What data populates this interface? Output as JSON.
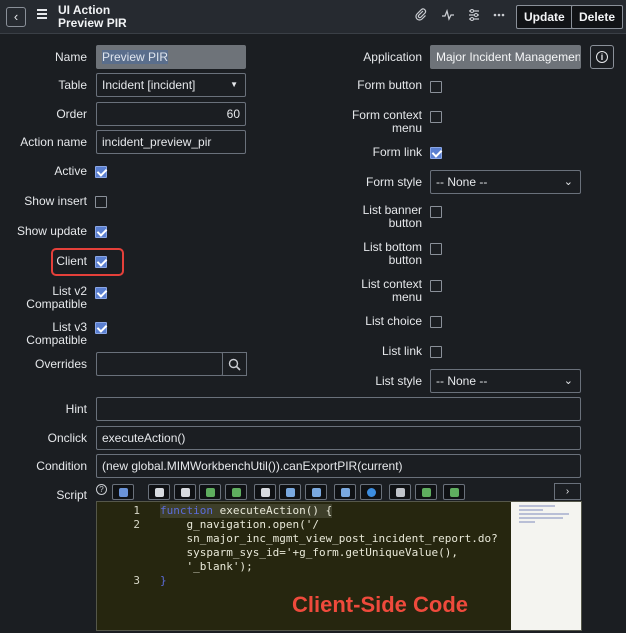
{
  "header": {
    "title": "UI Action",
    "subtitle": "Preview PIR",
    "update_label": "Update",
    "delete_label": "Delete"
  },
  "left_fields": {
    "name_label": "Name",
    "name_value": "Preview PIR",
    "table_label": "Table",
    "table_value": "Incident [incident]",
    "order_label": "Order",
    "order_value": "60",
    "action_name_label": "Action name",
    "action_name_value": "incident_preview_pir",
    "active_label": "Active",
    "show_insert_label": "Show insert",
    "show_update_label": "Show update",
    "client_label": "Client",
    "list_v2_label_1": "List v2",
    "list_v2_label_2": "Compatible",
    "list_v3_label_1": "List v3",
    "list_v3_label_2": "Compatible",
    "overrides_label": "Overrides",
    "overrides_value": ""
  },
  "right_fields": {
    "application_label": "Application",
    "application_value": "Major Incident Management",
    "form_button_label": "Form button",
    "form_context_label_1": "Form context",
    "form_context_label_2": "menu",
    "form_link_label": "Form link",
    "form_style_label": "Form style",
    "form_style_value": "-- None --",
    "list_banner_label_1": "List banner",
    "list_banner_label_2": "button",
    "list_bottom_label_1": "List bottom",
    "list_bottom_label_2": "button",
    "list_context_label_1": "List context",
    "list_context_label_2": "menu",
    "list_choice_label": "List choice",
    "list_link_label": "List link",
    "list_style_label": "List style",
    "list_style_value": "-- None --"
  },
  "checkbox_states": {
    "active": true,
    "show_insert": false,
    "show_update": true,
    "client": true,
    "list_v2": true,
    "list_v3": true,
    "form_button": false,
    "form_context_menu": false,
    "form_link": true,
    "list_banner_button": false,
    "list_bottom_button": false,
    "list_context_menu": false,
    "list_choice": false,
    "list_link": false
  },
  "wide_fields": {
    "hint_label": "Hint",
    "hint_value": "",
    "onclick_label": "Onclick",
    "onclick_value": "executeAction()",
    "condition_label": "Condition",
    "condition_value": "(new global.MIMWorkbenchUtil()).canExportPIR(current)",
    "script_label": "Script"
  },
  "script": {
    "line_numbers": [
      "1",
      "2",
      "3"
    ],
    "line1_keyword": "function",
    "line1_rest": " executeAction() {",
    "line2_a": "    g_navigation.open('/",
    "line2_b": "    sn_major_inc_mgmt_view_post_incident_report.do?",
    "line2_c": "    sysparm_sys_id='+g_form.getUniqueValue(),",
    "line2_d": "    '_blank');",
    "line3": "}"
  },
  "annotation": "Client-Side Code",
  "colors": {
    "highlight": "#e5403a",
    "checkbox_on": "#5a7fd0",
    "keyword": "#5b6cd9",
    "annotation": "#ef4a3c"
  },
  "icons": {
    "back": "chevron-left-icon",
    "menu": "hamburger-menu-icon",
    "attach": "paperclip-icon",
    "activity": "pulse-icon",
    "settings": "sliders-icon",
    "more": "ellipsis-icon",
    "info": "info-icon",
    "search": "search-icon",
    "help": "help-icon"
  }
}
